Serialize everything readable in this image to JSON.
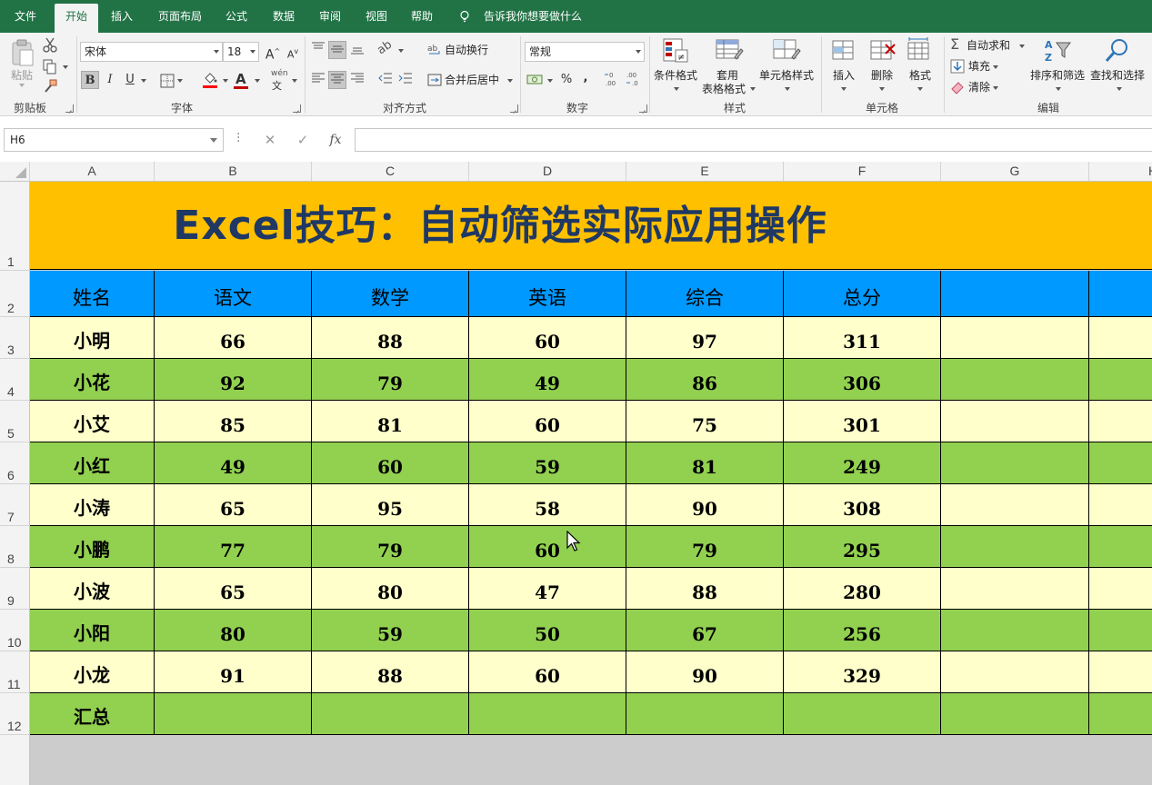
{
  "tabs": [
    {
      "label": "文件"
    },
    {
      "label": "开始"
    },
    {
      "label": "插入"
    },
    {
      "label": "页面布局"
    },
    {
      "label": "公式"
    },
    {
      "label": "数据"
    },
    {
      "label": "审阅"
    },
    {
      "label": "视图"
    },
    {
      "label": "帮助"
    }
  ],
  "tell_me": "告诉我你想要做什么",
  "ribbon": {
    "clipboard": {
      "paste": "粘贴",
      "group": "剪贴板"
    },
    "font": {
      "name": "宋体",
      "size": "18",
      "group": "字体",
      "bold": "B",
      "italic": "I",
      "underline": "U",
      "grow": "A",
      "shrink": "A",
      "phonetic_top": "wén",
      "phonetic_bottom": "文"
    },
    "align": {
      "wrap": "自动换行",
      "merge": "合并后居中",
      "group": "对齐方式"
    },
    "number": {
      "format": "常规",
      "percent": "%",
      "comma": ",",
      "group": "数字"
    },
    "styles": {
      "conditional": "条件格式",
      "table_line1": "套用",
      "table_line2": "表格格式",
      "cell_styles": "单元格样式",
      "group": "样式"
    },
    "cells": {
      "insert": "插入",
      "delete": "删除",
      "format": "格式",
      "group": "单元格"
    },
    "editing": {
      "autosum": "自动求和",
      "fill": "填充",
      "clear": "清除",
      "sort": "排序和筛选",
      "find": "查找和选择",
      "group": "编辑"
    }
  },
  "formula_bar": {
    "name_box": "H6",
    "fx": "fx",
    "value": ""
  },
  "columns": [
    "A",
    "B",
    "C",
    "D",
    "E",
    "F",
    "G",
    "H"
  ],
  "rows": [
    "1",
    "2",
    "3",
    "4",
    "5",
    "6",
    "7",
    "8",
    "9",
    "10",
    "11",
    "12"
  ],
  "sheet": {
    "title": "Excel技巧：自动筛选实际应用操作",
    "headers": [
      "姓名",
      "语文",
      "数学",
      "英语",
      "综合",
      "总分"
    ],
    "records": [
      [
        "小明",
        "66",
        "88",
        "60",
        "97",
        "311"
      ],
      [
        "小花",
        "92",
        "79",
        "49",
        "86",
        "306"
      ],
      [
        "小艾",
        "85",
        "81",
        "60",
        "75",
        "301"
      ],
      [
        "小红",
        "49",
        "60",
        "59",
        "81",
        "249"
      ],
      [
        "小涛",
        "65",
        "95",
        "58",
        "90",
        "308"
      ],
      [
        "小鹏",
        "77",
        "79",
        "60",
        "79",
        "295"
      ],
      [
        "小波",
        "65",
        "80",
        "47",
        "88",
        "280"
      ],
      [
        "小阳",
        "80",
        "59",
        "50",
        "67",
        "256"
      ],
      [
        "小龙",
        "91",
        "88",
        "60",
        "90",
        "329"
      ]
    ],
    "summary_label": "汇总"
  },
  "colors": {
    "ribbon_green": "#217346",
    "title_fill": "#ffc000",
    "title_text": "#1f3864",
    "header_fill": "#0099ff",
    "row_light": "#ffffcc",
    "row_green": "#92d050"
  }
}
